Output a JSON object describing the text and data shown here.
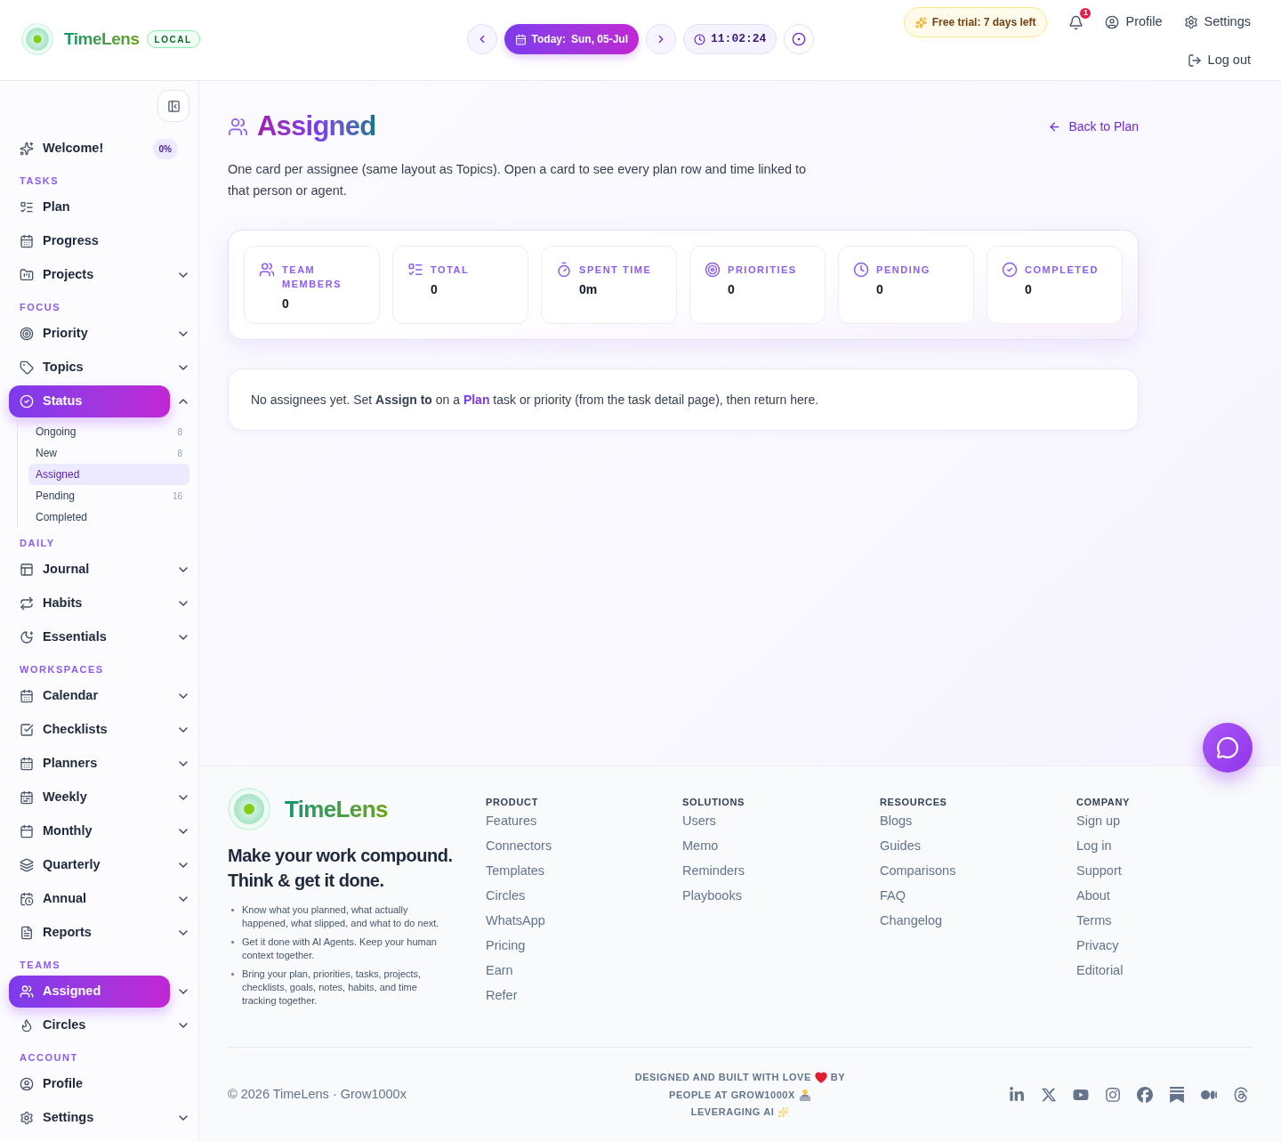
{
  "header": {
    "brand": {
      "name": "TimeLens",
      "badge": "LOCAL"
    },
    "date_nav": {
      "label": "Today:",
      "date": "Sun, 05-Jul"
    },
    "clock": "11:02:24",
    "trial": "Free trial: 7 days left",
    "notifications": {
      "count": "1"
    },
    "links": [
      {
        "label": "Profile"
      },
      {
        "label": "Settings"
      }
    ],
    "logout": "Log out"
  },
  "sidebar": {
    "welcome": {
      "label": "Welcome!",
      "progress": "0%",
      "selected": false
    },
    "sections": [
      {
        "title": "TASKS",
        "items": [
          {
            "label": "Plan",
            "selected": false
          },
          {
            "label": "Progress",
            "selected": false
          },
          {
            "label": "Projects",
            "selected": false,
            "expanded": false
          }
        ]
      },
      {
        "title": "FOCUS",
        "items": [
          {
            "label": "Priority",
            "selected": false,
            "expanded": false
          },
          {
            "label": "Topics",
            "selected": false,
            "expanded": false
          },
          {
            "label": "Status",
            "selected": true,
            "expanded": true,
            "children": [
              {
                "label": "Ongoing",
                "count": "8",
                "selected": false
              },
              {
                "label": "New",
                "count": "8",
                "selected": false
              },
              {
                "label": "Assigned",
                "selected": true
              },
              {
                "label": "Pending",
                "count": "16",
                "selected": false
              },
              {
                "label": "Completed",
                "selected": false
              }
            ]
          }
        ]
      },
      {
        "title": "DAILY",
        "items": [
          {
            "label": "Journal",
            "selected": false,
            "expanded": false
          },
          {
            "label": "Habits",
            "selected": false,
            "expanded": false
          },
          {
            "label": "Essentials",
            "selected": false,
            "expanded": false
          }
        ]
      },
      {
        "title": "WORKSPACES",
        "items": [
          {
            "label": "Calendar",
            "selected": false,
            "expanded": false
          },
          {
            "label": "Checklists",
            "selected": false,
            "expanded": false
          },
          {
            "label": "Planners",
            "selected": false,
            "expanded": false
          },
          {
            "label": "Weekly",
            "selected": false,
            "expanded": false
          },
          {
            "label": "Monthly",
            "selected": false,
            "expanded": false
          },
          {
            "label": "Quarterly",
            "selected": false,
            "expanded": false
          },
          {
            "label": "Annual",
            "selected": false,
            "expanded": false
          },
          {
            "label": "Reports",
            "selected": false,
            "expanded": false
          }
        ]
      },
      {
        "title": "TEAMS",
        "items": [
          {
            "label": "Assigned",
            "selected": true,
            "expanded": false
          },
          {
            "label": "Circles",
            "selected": false,
            "expanded": false
          }
        ]
      },
      {
        "title": "ACCOUNT",
        "items": [
          {
            "label": "Profile",
            "selected": false
          },
          {
            "label": "Settings",
            "selected": false,
            "expanded": false
          }
        ]
      }
    ]
  },
  "page": {
    "title": "Assigned",
    "back_link": "Back to Plan",
    "description": "One card per assignee (same layout as Topics). Open a card to see every plan row and time linked to that person or agent.",
    "stats": [
      {
        "label": "TEAM MEMBERS",
        "value": "0"
      },
      {
        "label": "TOTAL",
        "value": "0"
      },
      {
        "label": "SPENT TIME",
        "value": "0m"
      },
      {
        "label": "PRIORITIES",
        "value": "0"
      },
      {
        "label": "PENDING",
        "value": "0"
      },
      {
        "label": "COMPLETED",
        "value": "0"
      }
    ],
    "empty_state": {
      "before": "No assignees yet. Set **Assign to** on a",
      "link": "Plan",
      "after": "task or priority (from the task detail page), then return here."
    }
  },
  "footer": {
    "brand": "TimeLens",
    "tagline": [
      "Make your work compound.",
      "Think & get it done."
    ],
    "bullets": [
      "Know what you planned, what actually happened, what slipped, and what to do next.",
      "Get it done with AI Agents. Keep your human context together.",
      "Bring your plan, priorities, tasks, projects, checklists, goals, notes, habits, and time tracking together."
    ],
    "columns": [
      {
        "title": "PRODUCT",
        "links": [
          "Features",
          "Connectors",
          "Templates",
          "Circles",
          "WhatsApp",
          "Pricing",
          "Earn",
          "Refer"
        ]
      },
      {
        "title": "SOLUTIONS",
        "links": [
          "Users",
          "Memo",
          "Reminders",
          "Playbooks"
        ]
      },
      {
        "title": "RESOURCES",
        "links": [
          "Blogs",
          "Guides",
          "Comparisons",
          "FAQ",
          "Changelog"
        ]
      },
      {
        "title": "COMPANY",
        "links": [
          "Sign up",
          "Log in",
          "Support",
          "About",
          "Terms",
          "Privacy",
          "Editorial"
        ]
      }
    ],
    "copyright": "© 2026 TimeLens · Grow1000x",
    "credits": [
      {
        "text": "DESIGNED AND BUILT WITH LOVE",
        "after": "BY"
      },
      {
        "text": "PEOPLE AT GROW1000X"
      },
      {
        "text": "LEVERAGING AI"
      }
    ]
  }
}
